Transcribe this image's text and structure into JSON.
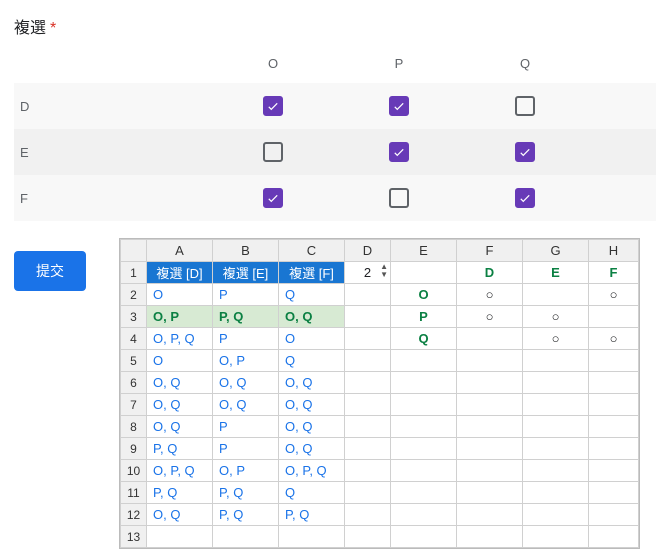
{
  "form": {
    "title": "複選",
    "required_mark": "*",
    "columns": [
      "O",
      "P",
      "Q"
    ],
    "rows": [
      {
        "label": "D",
        "alt": "alt2",
        "cells": [
          true,
          true,
          false
        ]
      },
      {
        "label": "E",
        "alt": "alt",
        "cells": [
          false,
          true,
          true
        ]
      },
      {
        "label": "F",
        "alt": "alt2",
        "cells": [
          true,
          false,
          true
        ]
      }
    ],
    "submit_label": "提交"
  },
  "spreadsheet": {
    "col_headers": [
      "A",
      "B",
      "C",
      "D",
      "E",
      "F",
      "G",
      "H"
    ],
    "rows": [
      {
        "n": "1",
        "cells": [
          {
            "t": "複選 [D]",
            "cls": "hdr-blue"
          },
          {
            "t": "複選 [E]",
            "cls": "hdr-blue"
          },
          {
            "t": "複選 [F]",
            "cls": "hdr-blue"
          },
          {
            "t": "2",
            "cls": "spinner"
          },
          {
            "t": ""
          },
          {
            "t": "D",
            "cls": "green-ctr"
          },
          {
            "t": "E",
            "cls": "green-ctr"
          },
          {
            "t": "F",
            "cls": "green-ctr"
          }
        ]
      },
      {
        "n": "2",
        "cells": [
          {
            "t": "O",
            "cls": "blue-txt"
          },
          {
            "t": "P",
            "cls": "blue-txt"
          },
          {
            "t": "Q",
            "cls": "blue-txt"
          },
          {
            "t": ""
          },
          {
            "t": "O",
            "cls": "green-ctr"
          },
          {
            "t": "○",
            "cls": "circle"
          },
          {
            "t": ""
          },
          {
            "t": "○",
            "cls": "circle"
          }
        ]
      },
      {
        "n": "3",
        "cells": [
          {
            "t": "O, P",
            "cls": "green-txt green-bg"
          },
          {
            "t": "P, Q",
            "cls": "green-txt green-bg"
          },
          {
            "t": "O, Q",
            "cls": "green-txt green-bg"
          },
          {
            "t": ""
          },
          {
            "t": "P",
            "cls": "green-ctr"
          },
          {
            "t": "○",
            "cls": "circle"
          },
          {
            "t": "○",
            "cls": "circle"
          },
          {
            "t": ""
          }
        ]
      },
      {
        "n": "4",
        "cells": [
          {
            "t": "O, P, Q",
            "cls": "blue-txt"
          },
          {
            "t": "P",
            "cls": "blue-txt"
          },
          {
            "t": "O",
            "cls": "blue-txt"
          },
          {
            "t": ""
          },
          {
            "t": "Q",
            "cls": "green-ctr"
          },
          {
            "t": ""
          },
          {
            "t": "○",
            "cls": "circle"
          },
          {
            "t": "○",
            "cls": "circle"
          }
        ]
      },
      {
        "n": "5",
        "cells": [
          {
            "t": "O",
            "cls": "blue-txt"
          },
          {
            "t": "O, P",
            "cls": "blue-txt"
          },
          {
            "t": "Q",
            "cls": "blue-txt"
          },
          {
            "t": ""
          },
          {
            "t": ""
          },
          {
            "t": ""
          },
          {
            "t": ""
          },
          {
            "t": ""
          }
        ]
      },
      {
        "n": "6",
        "cells": [
          {
            "t": "O, Q",
            "cls": "blue-txt"
          },
          {
            "t": "O, Q",
            "cls": "blue-txt"
          },
          {
            "t": "O, Q",
            "cls": "blue-txt"
          },
          {
            "t": ""
          },
          {
            "t": ""
          },
          {
            "t": ""
          },
          {
            "t": ""
          },
          {
            "t": ""
          }
        ]
      },
      {
        "n": "7",
        "cells": [
          {
            "t": "O, Q",
            "cls": "blue-txt"
          },
          {
            "t": "O, Q",
            "cls": "blue-txt"
          },
          {
            "t": "O, Q",
            "cls": "blue-txt"
          },
          {
            "t": ""
          },
          {
            "t": ""
          },
          {
            "t": ""
          },
          {
            "t": ""
          },
          {
            "t": ""
          }
        ]
      },
      {
        "n": "8",
        "cells": [
          {
            "t": "O, Q",
            "cls": "blue-txt"
          },
          {
            "t": "P",
            "cls": "blue-txt"
          },
          {
            "t": "O, Q",
            "cls": "blue-txt"
          },
          {
            "t": ""
          },
          {
            "t": ""
          },
          {
            "t": ""
          },
          {
            "t": ""
          },
          {
            "t": ""
          }
        ]
      },
      {
        "n": "9",
        "cells": [
          {
            "t": "P, Q",
            "cls": "blue-txt"
          },
          {
            "t": "P",
            "cls": "blue-txt"
          },
          {
            "t": "O, Q",
            "cls": "blue-txt"
          },
          {
            "t": ""
          },
          {
            "t": ""
          },
          {
            "t": ""
          },
          {
            "t": ""
          },
          {
            "t": ""
          }
        ]
      },
      {
        "n": "10",
        "cells": [
          {
            "t": "O, P, Q",
            "cls": "blue-txt"
          },
          {
            "t": "O, P",
            "cls": "blue-txt"
          },
          {
            "t": "O, P, Q",
            "cls": "blue-txt"
          },
          {
            "t": ""
          },
          {
            "t": ""
          },
          {
            "t": ""
          },
          {
            "t": ""
          },
          {
            "t": ""
          }
        ]
      },
      {
        "n": "11",
        "cells": [
          {
            "t": "P, Q",
            "cls": "blue-txt"
          },
          {
            "t": "P, Q",
            "cls": "blue-txt"
          },
          {
            "t": "Q",
            "cls": "blue-txt"
          },
          {
            "t": ""
          },
          {
            "t": ""
          },
          {
            "t": ""
          },
          {
            "t": ""
          },
          {
            "t": ""
          }
        ]
      },
      {
        "n": "12",
        "cells": [
          {
            "t": "O, Q",
            "cls": "blue-txt"
          },
          {
            "t": "P, Q",
            "cls": "blue-txt"
          },
          {
            "t": "P, Q",
            "cls": "blue-txt"
          },
          {
            "t": ""
          },
          {
            "t": ""
          },
          {
            "t": ""
          },
          {
            "t": ""
          },
          {
            "t": ""
          }
        ]
      },
      {
        "n": "13",
        "cells": [
          {
            "t": ""
          },
          {
            "t": ""
          },
          {
            "t": ""
          },
          {
            "t": ""
          },
          {
            "t": ""
          },
          {
            "t": ""
          },
          {
            "t": ""
          },
          {
            "t": ""
          }
        ]
      }
    ]
  }
}
